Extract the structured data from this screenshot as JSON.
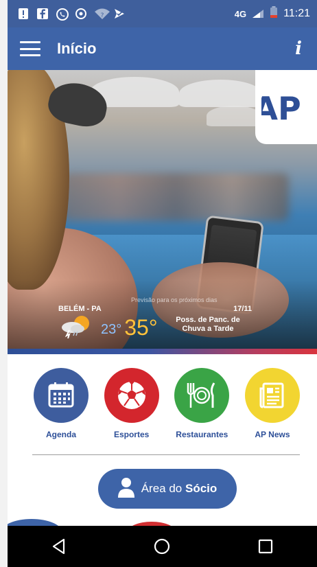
{
  "status_bar": {
    "network": "4G",
    "time": "11:21"
  },
  "header": {
    "title": "Início",
    "info_label": "i"
  },
  "hero": {
    "logo_text": "AP",
    "weather": {
      "caption": "Previsão para os próximos dias",
      "city": "BELÉM - PA",
      "date": "17/11",
      "min_temp": "23°",
      "max_temp": "35°",
      "forecast": "Poss. de Panc. de Chuva a Tarde"
    }
  },
  "menu": {
    "items": [
      {
        "label": "Agenda",
        "icon": "calendar-icon",
        "color": "#3e5d9e"
      },
      {
        "label": "Esportes",
        "icon": "soccer-ball-icon",
        "color": "#d3262d"
      },
      {
        "label": "Restaurantes",
        "icon": "plate-cutlery-icon",
        "color": "#3aa446"
      },
      {
        "label": "AP News",
        "icon": "newspaper-icon",
        "color": "#f2d531"
      }
    ]
  },
  "socio_button": {
    "prefix": "Área do",
    "bold": "Sócio"
  },
  "colors": {
    "primary": "#3e64a8",
    "statusbar": "#3f5f9c",
    "label": "#2d4f98"
  }
}
